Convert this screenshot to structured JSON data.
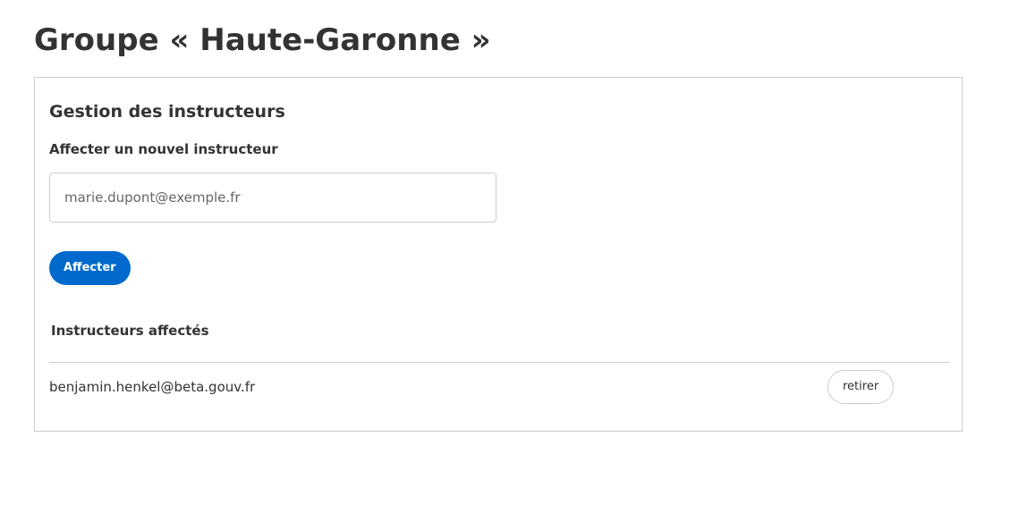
{
  "page": {
    "title": "Groupe « Haute-Garonne »"
  },
  "instructors_panel": {
    "title": "Gestion des instructeurs",
    "assign_label": "Affecter un nouvel instructeur",
    "email_input": {
      "value": "",
      "placeholder": "marie.dupont@exemple.fr"
    },
    "assign_button_label": "Affecter",
    "assigned_header": "Instructeurs affectés",
    "assigned": [
      {
        "email": "benjamin.henkel@beta.gouv.fr",
        "remove_label": "retirer"
      }
    ]
  },
  "colors": {
    "primary": "#0069cc",
    "border": "#cccccc",
    "text": "#333333"
  }
}
